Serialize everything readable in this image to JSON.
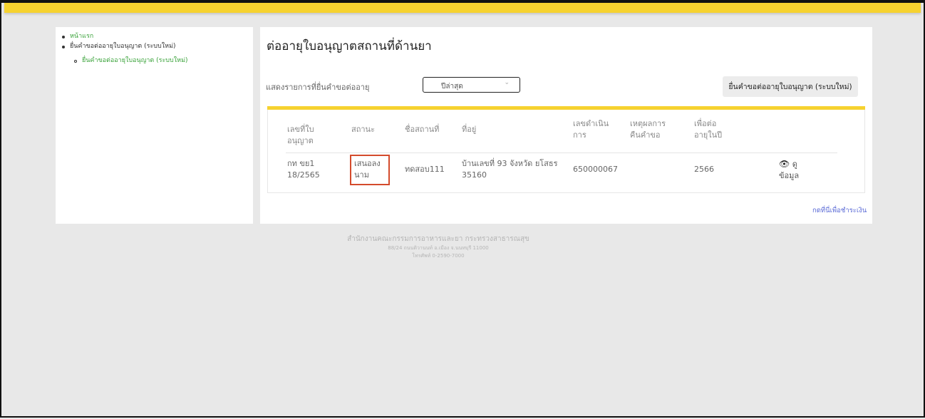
{
  "sidebar": {
    "items": [
      {
        "label": "หน้าแรก",
        "level": 0,
        "color": "#3aa33a"
      },
      {
        "label": "ยื่นคำขอต่ออายุใบอนุญาต (ระบบใหม่)",
        "level": 0,
        "color": "#333333"
      },
      {
        "label": "ยื่นคำขอต่ออายุใบอนุญาต (ระบบใหม่)",
        "level": 1,
        "color": "#3aa33a"
      }
    ]
  },
  "main": {
    "title": "ต่ออายุใบอนุญาตสถานที่ด้านยา",
    "filter_label": "แสดงรายการที่ยื่นคำขอต่ออายุ",
    "year_select_value": "ปีล่าสุด",
    "new_request_button": "ยื่นคำขอต่ออายุใบอนุญาต (ระบบใหม่)",
    "table": {
      "headers": [
        "เลขที่ใบอนุญาต",
        "สถานะ",
        "ชื่อสถานที่",
        "ที่อยู่",
        "เลขดำเนินการ",
        "เหตุผลการคืนคำขอ",
        "เพื่อต่ออายุในปี"
      ],
      "rows": [
        {
          "license_no": "กท ขย1 18/2565",
          "status": "เสนอลงนาม",
          "place_name": "ทดสอบ111",
          "address": "บ้านเลขที่ 93 จังหวัด ยโสธร 35160",
          "process_no": "650000067",
          "return_reason": "",
          "renew_year": "2566",
          "view_label": "ดูข้อมูล"
        }
      ]
    },
    "back_link": "กดที่นี่เพื่อชำระเงิน"
  },
  "footer": {
    "line1": "สำนักงานคณะกรรมการอาหารและยา กระทรวงสาธารณสุข",
    "line2": "88/24 ถนนติวานนท์ อ.เมือง จ.นนทบุรี 11000",
    "line3": "โทรศัพท์ 0-2590-7000"
  },
  "colors": {
    "accent_yellow": "#f6d22f",
    "highlight_red": "#d44b2c",
    "link_blue": "#5b6bd6",
    "link_green": "#3aa33a"
  }
}
